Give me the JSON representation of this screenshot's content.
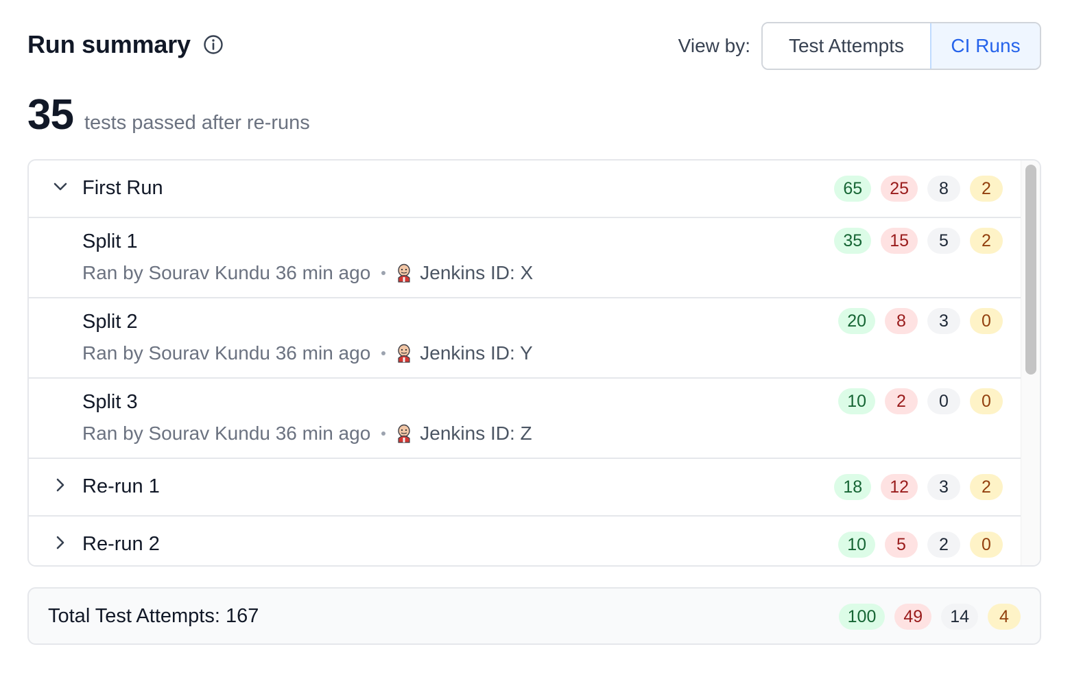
{
  "header": {
    "title": "Run summary",
    "view_by_label": "View by:",
    "view_options": [
      "Test Attempts",
      "CI Runs"
    ],
    "selected_view": "CI Runs"
  },
  "summary": {
    "passed_count": "35",
    "passed_label": "tests passed after re-runs"
  },
  "runs": [
    {
      "label": "First Run",
      "expanded": true,
      "counts": {
        "passed": "65",
        "failed": "25",
        "skipped": "8",
        "flaky": "2"
      },
      "splits": [
        {
          "label": "Split 1",
          "meta": "Ran by Sourav Kundu 36 min ago",
          "jenkins": "Jenkins ID: X",
          "counts": {
            "passed": "35",
            "failed": "15",
            "skipped": "5",
            "flaky": "2"
          }
        },
        {
          "label": "Split 2",
          "meta": "Ran by Sourav Kundu 36 min ago",
          "jenkins": "Jenkins ID: Y",
          "counts": {
            "passed": "20",
            "failed": "8",
            "skipped": "3",
            "flaky": "0"
          }
        },
        {
          "label": "Split 3",
          "meta": "Ran by Sourav Kundu 36 min ago",
          "jenkins": "Jenkins ID: Z",
          "counts": {
            "passed": "10",
            "failed": "2",
            "skipped": "0",
            "flaky": "0"
          }
        }
      ]
    },
    {
      "label": "Re-run 1",
      "expanded": false,
      "counts": {
        "passed": "18",
        "failed": "12",
        "skipped": "3",
        "flaky": "2"
      }
    },
    {
      "label": "Re-run 2",
      "expanded": false,
      "counts": {
        "passed": "10",
        "failed": "5",
        "skipped": "2",
        "flaky": "0"
      }
    }
  ],
  "total": {
    "label": "Total Test Attempts: 167",
    "counts": {
      "passed": "100",
      "failed": "49",
      "skipped": "14",
      "flaky": "4"
    }
  },
  "colors": {
    "passed_bg": "#dcfce7",
    "passed_fg": "#166534",
    "failed_bg": "#fee2e2",
    "failed_fg": "#991b1b",
    "skipped_bg": "#f3f4f6",
    "skipped_fg": "#1f2937",
    "flaky_bg": "#fef3c7",
    "flaky_fg": "#92400e",
    "accent": "#2563eb"
  },
  "icons": {
    "info": "info-icon",
    "expanded": "chevron-down-icon",
    "collapsed": "chevron-right-icon",
    "ci": "jenkins-icon"
  }
}
